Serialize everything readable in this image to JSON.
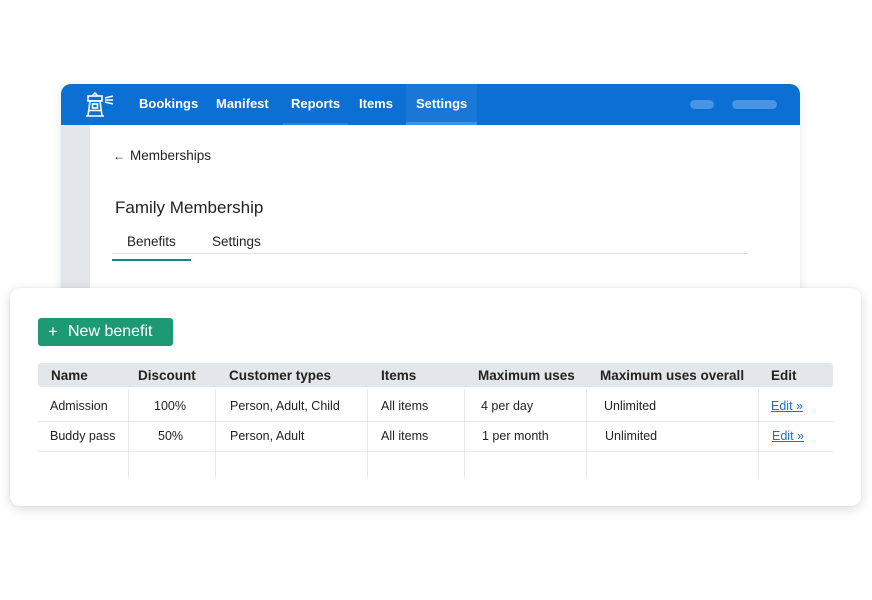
{
  "nav": {
    "items": [
      "Bookings",
      "Manifest",
      "Reports",
      "Items",
      "Settings"
    ],
    "active": "Settings",
    "accent_color": "#0b6fd3",
    "logo_icon": "lighthouse-icon"
  },
  "breadcrumb": {
    "back_label": "Memberships",
    "arrow": "←"
  },
  "page": {
    "title": "Family Membership",
    "tabs": [
      "Benefits",
      "Settings"
    ],
    "active_tab": "Benefits"
  },
  "benefits": {
    "new_button_label": "New benefit",
    "new_button_icon": "+",
    "button_color": "#1d9a74",
    "columns": [
      "Name",
      "Discount",
      "Customer types",
      "Items",
      "Maximum uses",
      "Maximum uses overall",
      "Edit"
    ],
    "rows": [
      [
        "Admission",
        "100%",
        "Person, Adult, Child",
        "All items",
        "4 per day",
        "Unlimited",
        "Edit »"
      ],
      [
        "Buddy pass",
        "50%",
        "Person, Adult",
        "All items",
        "1 per month",
        "Unlimited",
        "Edit »"
      ]
    ]
  }
}
